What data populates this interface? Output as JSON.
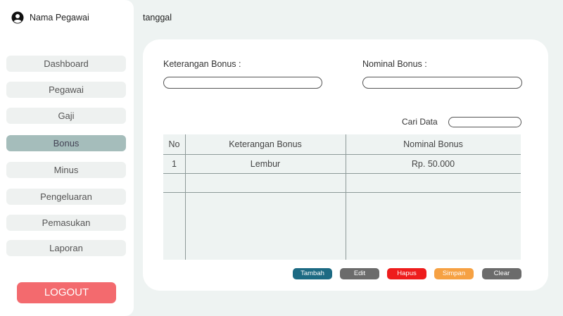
{
  "user": {
    "name": "Nama Pegawai",
    "icon": "user-circle-icon"
  },
  "header": {
    "date_label": "tanggal"
  },
  "sidebar": {
    "items": [
      {
        "label": "Dashboard"
      },
      {
        "label": "Pegawai"
      },
      {
        "label": "Gaji"
      },
      {
        "label": "Bonus",
        "active": true
      },
      {
        "label": "Minus"
      },
      {
        "label": "Pengeluaran"
      },
      {
        "label": "Pemasukan"
      },
      {
        "label": "Laporan"
      }
    ],
    "logout_label": "LOGOUT"
  },
  "form": {
    "keterangan_label": "Keterangan Bonus :",
    "keterangan_value": "",
    "nominal_label": "Nominal Bonus :",
    "nominal_value": ""
  },
  "search": {
    "label": "Cari Data",
    "value": ""
  },
  "table": {
    "headers": {
      "no": "No",
      "keterangan": "Keterangan Bonus",
      "nominal": "Nominal Bonus"
    },
    "rows": [
      {
        "no": "1",
        "keterangan": "Lembur",
        "nominal": "Rp. 50.000"
      },
      {
        "no": "",
        "keterangan": "",
        "nominal": ""
      }
    ]
  },
  "buttons": {
    "tambah": "Tambah",
    "edit": "Edit",
    "hapus": "Hapus",
    "simpan": "Simpan",
    "clear": "Clear"
  },
  "colors": {
    "active_nav": "#a5bdbb",
    "logout": "#f36a6e",
    "tambah": "#1c6a83",
    "edit": "#6b6b6b",
    "hapus": "#ee1c1c",
    "simpan": "#f6a143",
    "clear": "#6b6b6b"
  }
}
